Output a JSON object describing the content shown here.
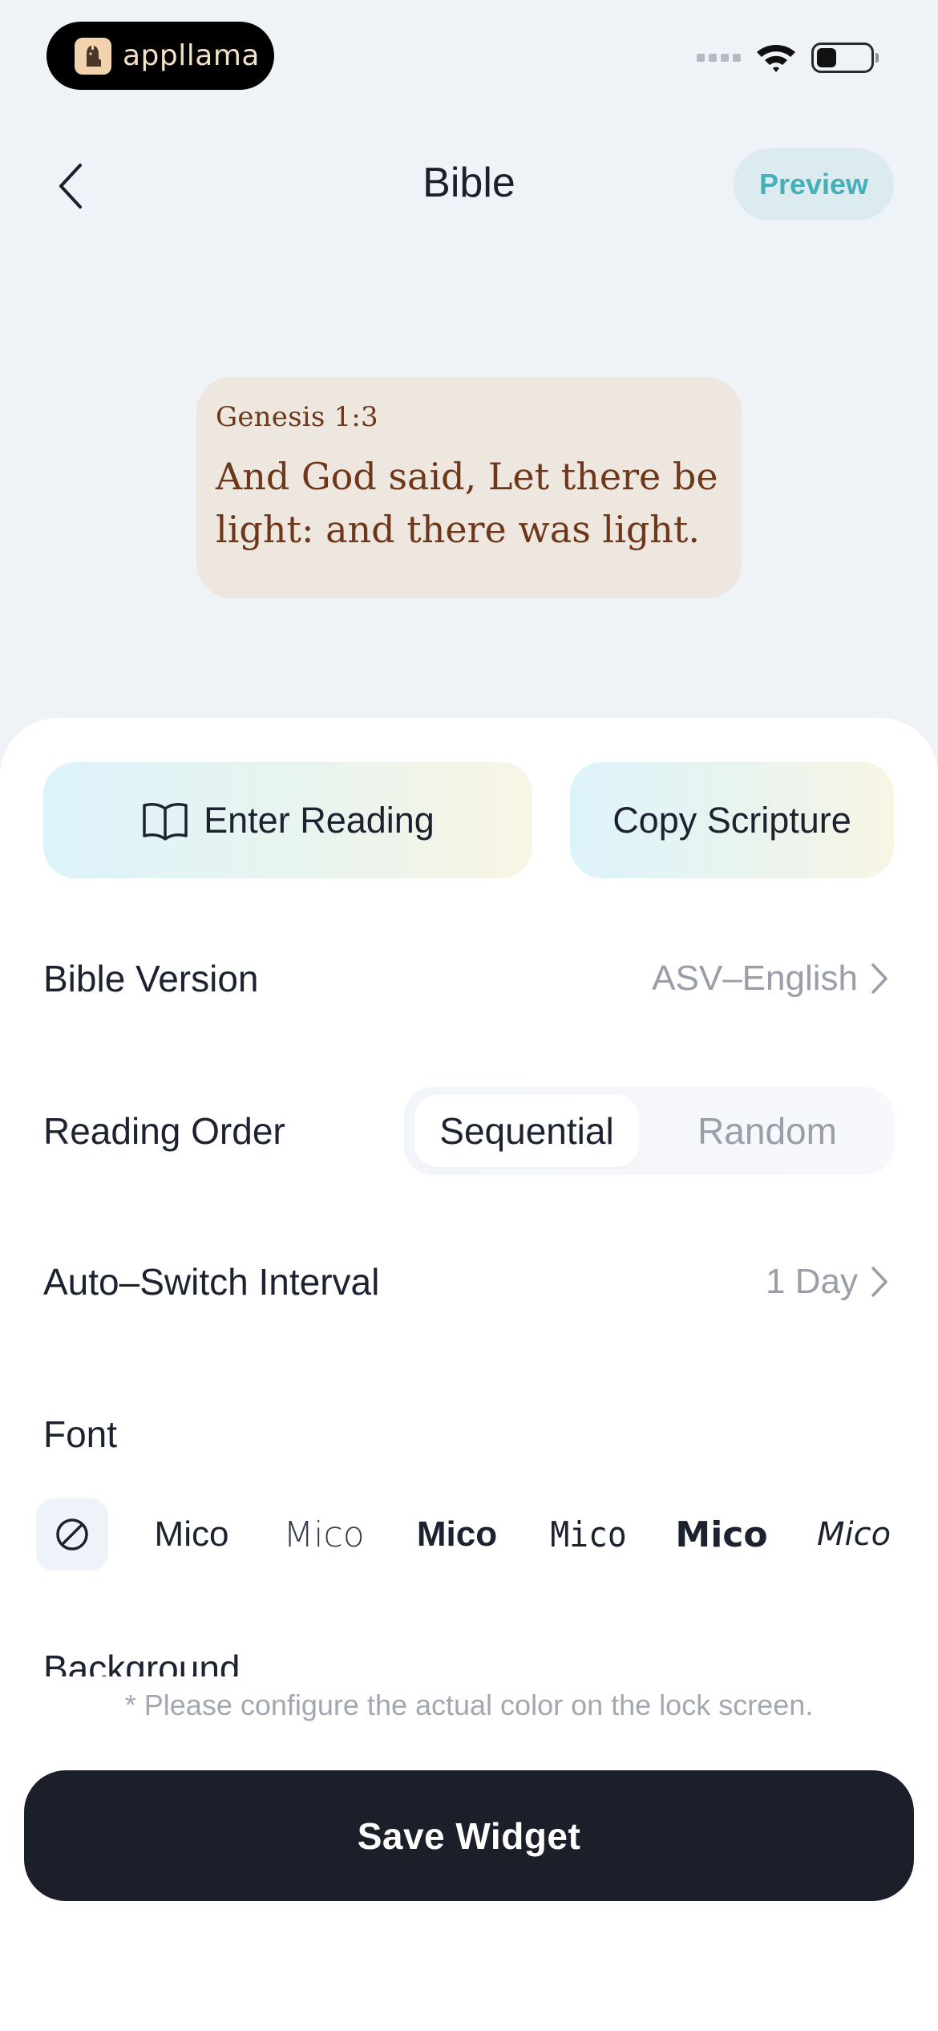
{
  "status_bar": {
    "brand_name": "appllama",
    "icons": [
      "signal-icon",
      "wifi-icon",
      "battery-icon"
    ]
  },
  "nav": {
    "title": "Bible",
    "preview_label": "Preview",
    "back_icon": "chevron-left-icon"
  },
  "widget_preview": {
    "reference": "Genesis 1:3",
    "verse": "And God said, Let there be light: and there was light."
  },
  "actions": {
    "enter_reading_label": "Enter Reading",
    "enter_reading_icon": "book-open-icon",
    "copy_scripture_label": "Copy Scripture"
  },
  "settings": {
    "bible_version": {
      "label": "Bible Version",
      "value": "ASV–English"
    },
    "reading_order": {
      "label": "Reading Order",
      "options": [
        "Sequential",
        "Random"
      ],
      "selected": "Sequential"
    },
    "auto_switch": {
      "label": "Auto–Switch Interval",
      "value": "1 Day"
    },
    "font": {
      "label": "Font",
      "none_icon": "no-font-icon",
      "options": [
        "Mico",
        "Mico",
        "Mico",
        "Mico",
        "Mico",
        "Mico"
      ]
    },
    "background": {
      "label": "Background"
    }
  },
  "note": "* Please configure the actual color on the lock screen.",
  "save_label": "Save Widget",
  "colors": {
    "accent": "#45b0b8",
    "card_bg": "#ede7e0",
    "card_text": "#6e3719",
    "save_bg": "#1b1f2a"
  }
}
